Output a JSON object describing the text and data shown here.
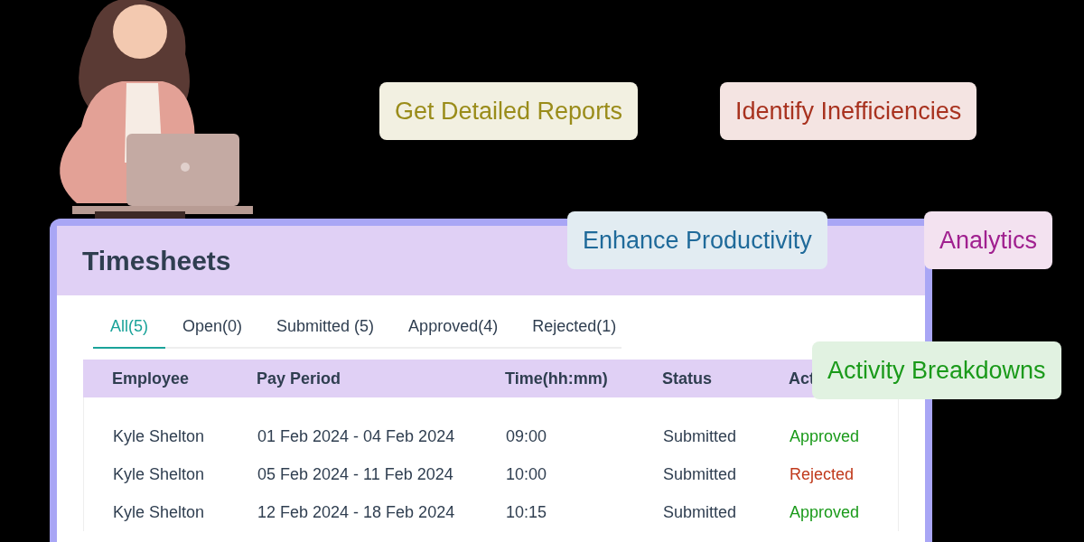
{
  "callouts": [
    {
      "text": "Get Detailed Reports",
      "color": "#9a8c1a"
    },
    {
      "text": "Identify Inefficiencies",
      "color": "#a8321f"
    },
    {
      "text": "Enhance Productivity",
      "color": "#1f6a9a"
    },
    {
      "text": "Analytics",
      "color": "#a0208f"
    },
    {
      "text": "Activity Breakdowns",
      "color": "#1a9a1a"
    }
  ],
  "panel": {
    "title": "Timesheets",
    "tabs": [
      {
        "label": "All(5)",
        "selected": true
      },
      {
        "label": "Open(0)",
        "selected": false
      },
      {
        "label": "Submitted (5)",
        "selected": false
      },
      {
        "label": "Approved(4)",
        "selected": false
      },
      {
        "label": "Rejected(1)",
        "selected": false
      }
    ],
    "table": {
      "columns": [
        "Employee",
        "Pay Period",
        "Time(hh:mm)",
        "Status",
        "Act"
      ],
      "rows": [
        {
          "employee": "Kyle Shelton",
          "pay_period": "01 Feb 2024 - 04 Feb 2024",
          "time": "09:00",
          "status": "Submitted",
          "action": {
            "text": "Approved",
            "color": "#1a9a1a"
          }
        },
        {
          "employee": "Kyle Shelton",
          "pay_period": "05 Feb 2024 - 11 Feb 2024",
          "time": "10:00",
          "status": "Submitted",
          "action": {
            "text": "Rejected",
            "color": "#c0391b"
          }
        },
        {
          "employee": "Kyle Shelton",
          "pay_period": "12 Feb 2024 - 18 Feb 2024",
          "time": "10:15",
          "status": "Submitted",
          "action": {
            "text": "Approved",
            "color": "#1a9a1a"
          }
        }
      ]
    }
  }
}
